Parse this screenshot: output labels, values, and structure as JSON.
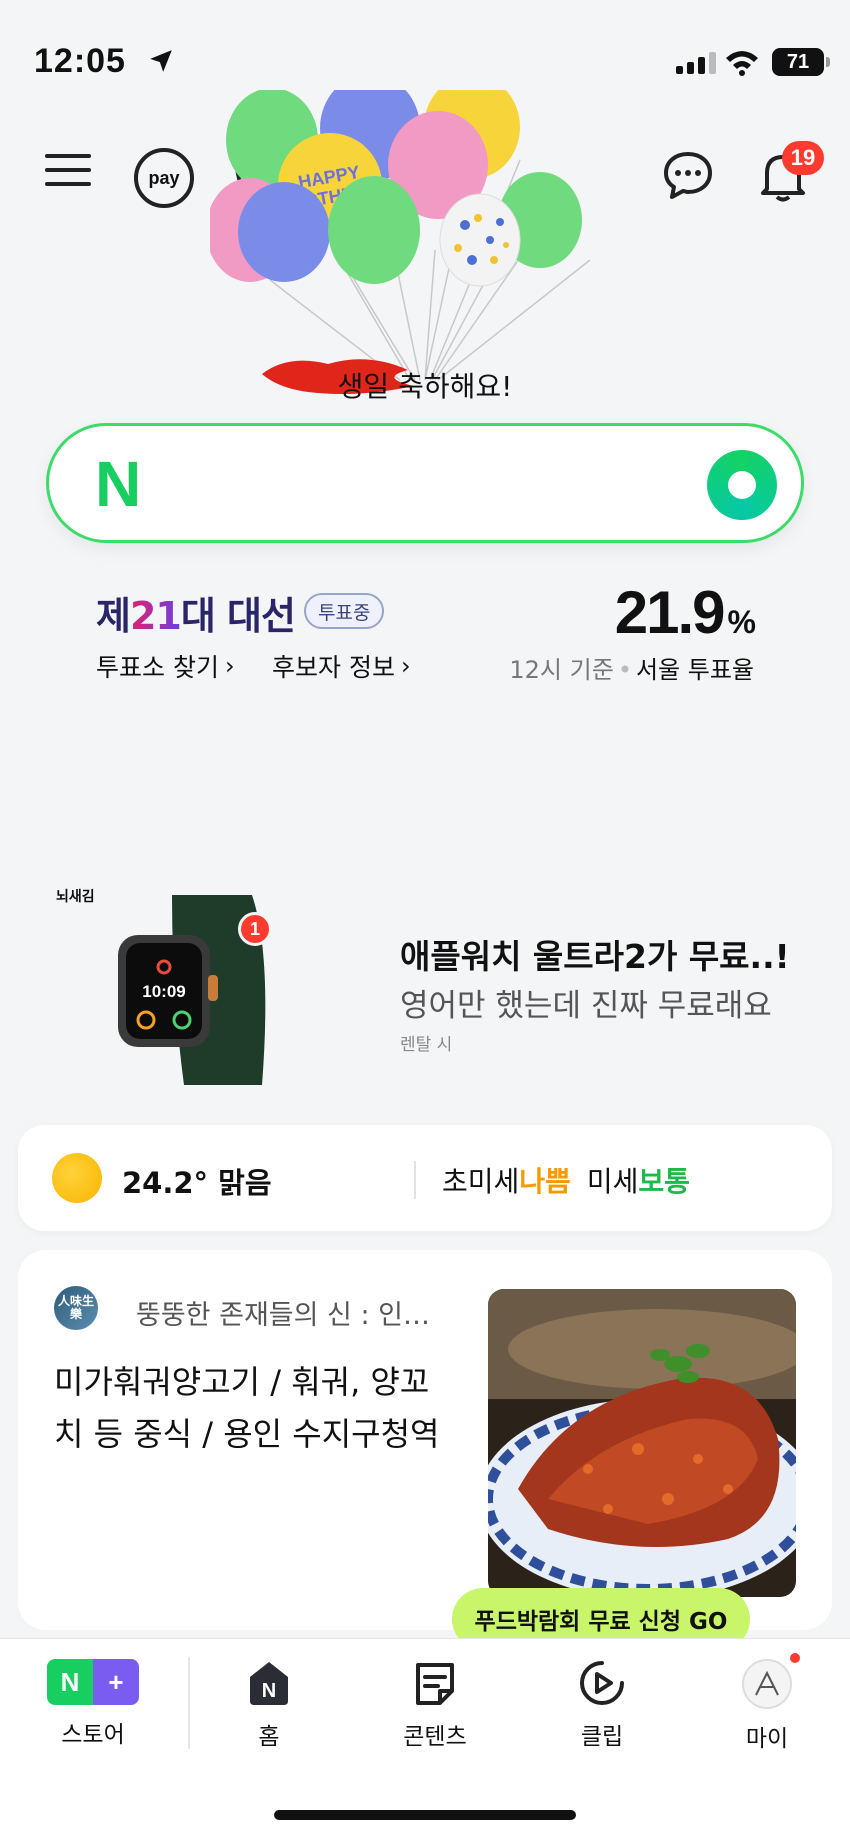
{
  "status_bar": {
    "time": "12:05",
    "battery": "71"
  },
  "header": {
    "pay_label": "pay",
    "notification_count": "19"
  },
  "birthday": {
    "balloon_text": "HAPPY BIRTHDAY",
    "message": "생일 축하해요!"
  },
  "search": {
    "logo": "N",
    "value": ""
  },
  "election": {
    "title_prefix": "제",
    "title_number": "21",
    "title_suffix": "대 대선",
    "badge": "투표중",
    "link1": "투표소 찾기",
    "link2": "후보자 정보",
    "turnout": "21.9",
    "turnout_unit": "%",
    "caption_time": "12시 기준",
    "caption_label": "서울 투표율"
  },
  "ad": {
    "brand": "뇌새김",
    "badge": "1",
    "title": "애플워치 울트라2가 무료..!",
    "subtitle": "영어만 했는데 진짜 무료래요",
    "label": "렌탈 시",
    "watch_time": "10:09"
  },
  "weather": {
    "temperature": "24.2° 맑음",
    "fine_dust_label": "초미세",
    "fine_dust_value": "나쁨",
    "dust_label": "미세",
    "dust_value": "보통"
  },
  "post": {
    "avatar_text": "人味生樂",
    "channel": "뚱뚱한 존재들의 신 : 인…",
    "title": "미가훠궈양고기 / 훠궈, 양꼬치 등 중식 / 용인 수지구청역"
  },
  "promo": {
    "label": "푸드박람회 무료 신청 GO"
  },
  "bottom_nav": [
    {
      "label": "스토어"
    },
    {
      "label": "홈"
    },
    {
      "label": "콘텐츠"
    },
    {
      "label": "클립"
    },
    {
      "label": "마이"
    }
  ],
  "colors": {
    "naver_green": "#19ce60",
    "search_border": "#3ddc6a",
    "badge_red": "#ff3b30",
    "dust_bad": "#f59a00",
    "dust_ok": "#1fb84a",
    "promo": "#c9f56a",
    "store_purple": "#7b5cf0"
  },
  "icons": [
    "location-arrow-icon",
    "signal-icon",
    "wifi-icon",
    "battery-icon",
    "menu-icon",
    "pay-icon",
    "cart-icon",
    "chat-icon",
    "bell-icon",
    "lens-icon",
    "sun-icon",
    "store-icon",
    "home-icon",
    "content-icon",
    "clip-icon",
    "my-icon"
  ]
}
